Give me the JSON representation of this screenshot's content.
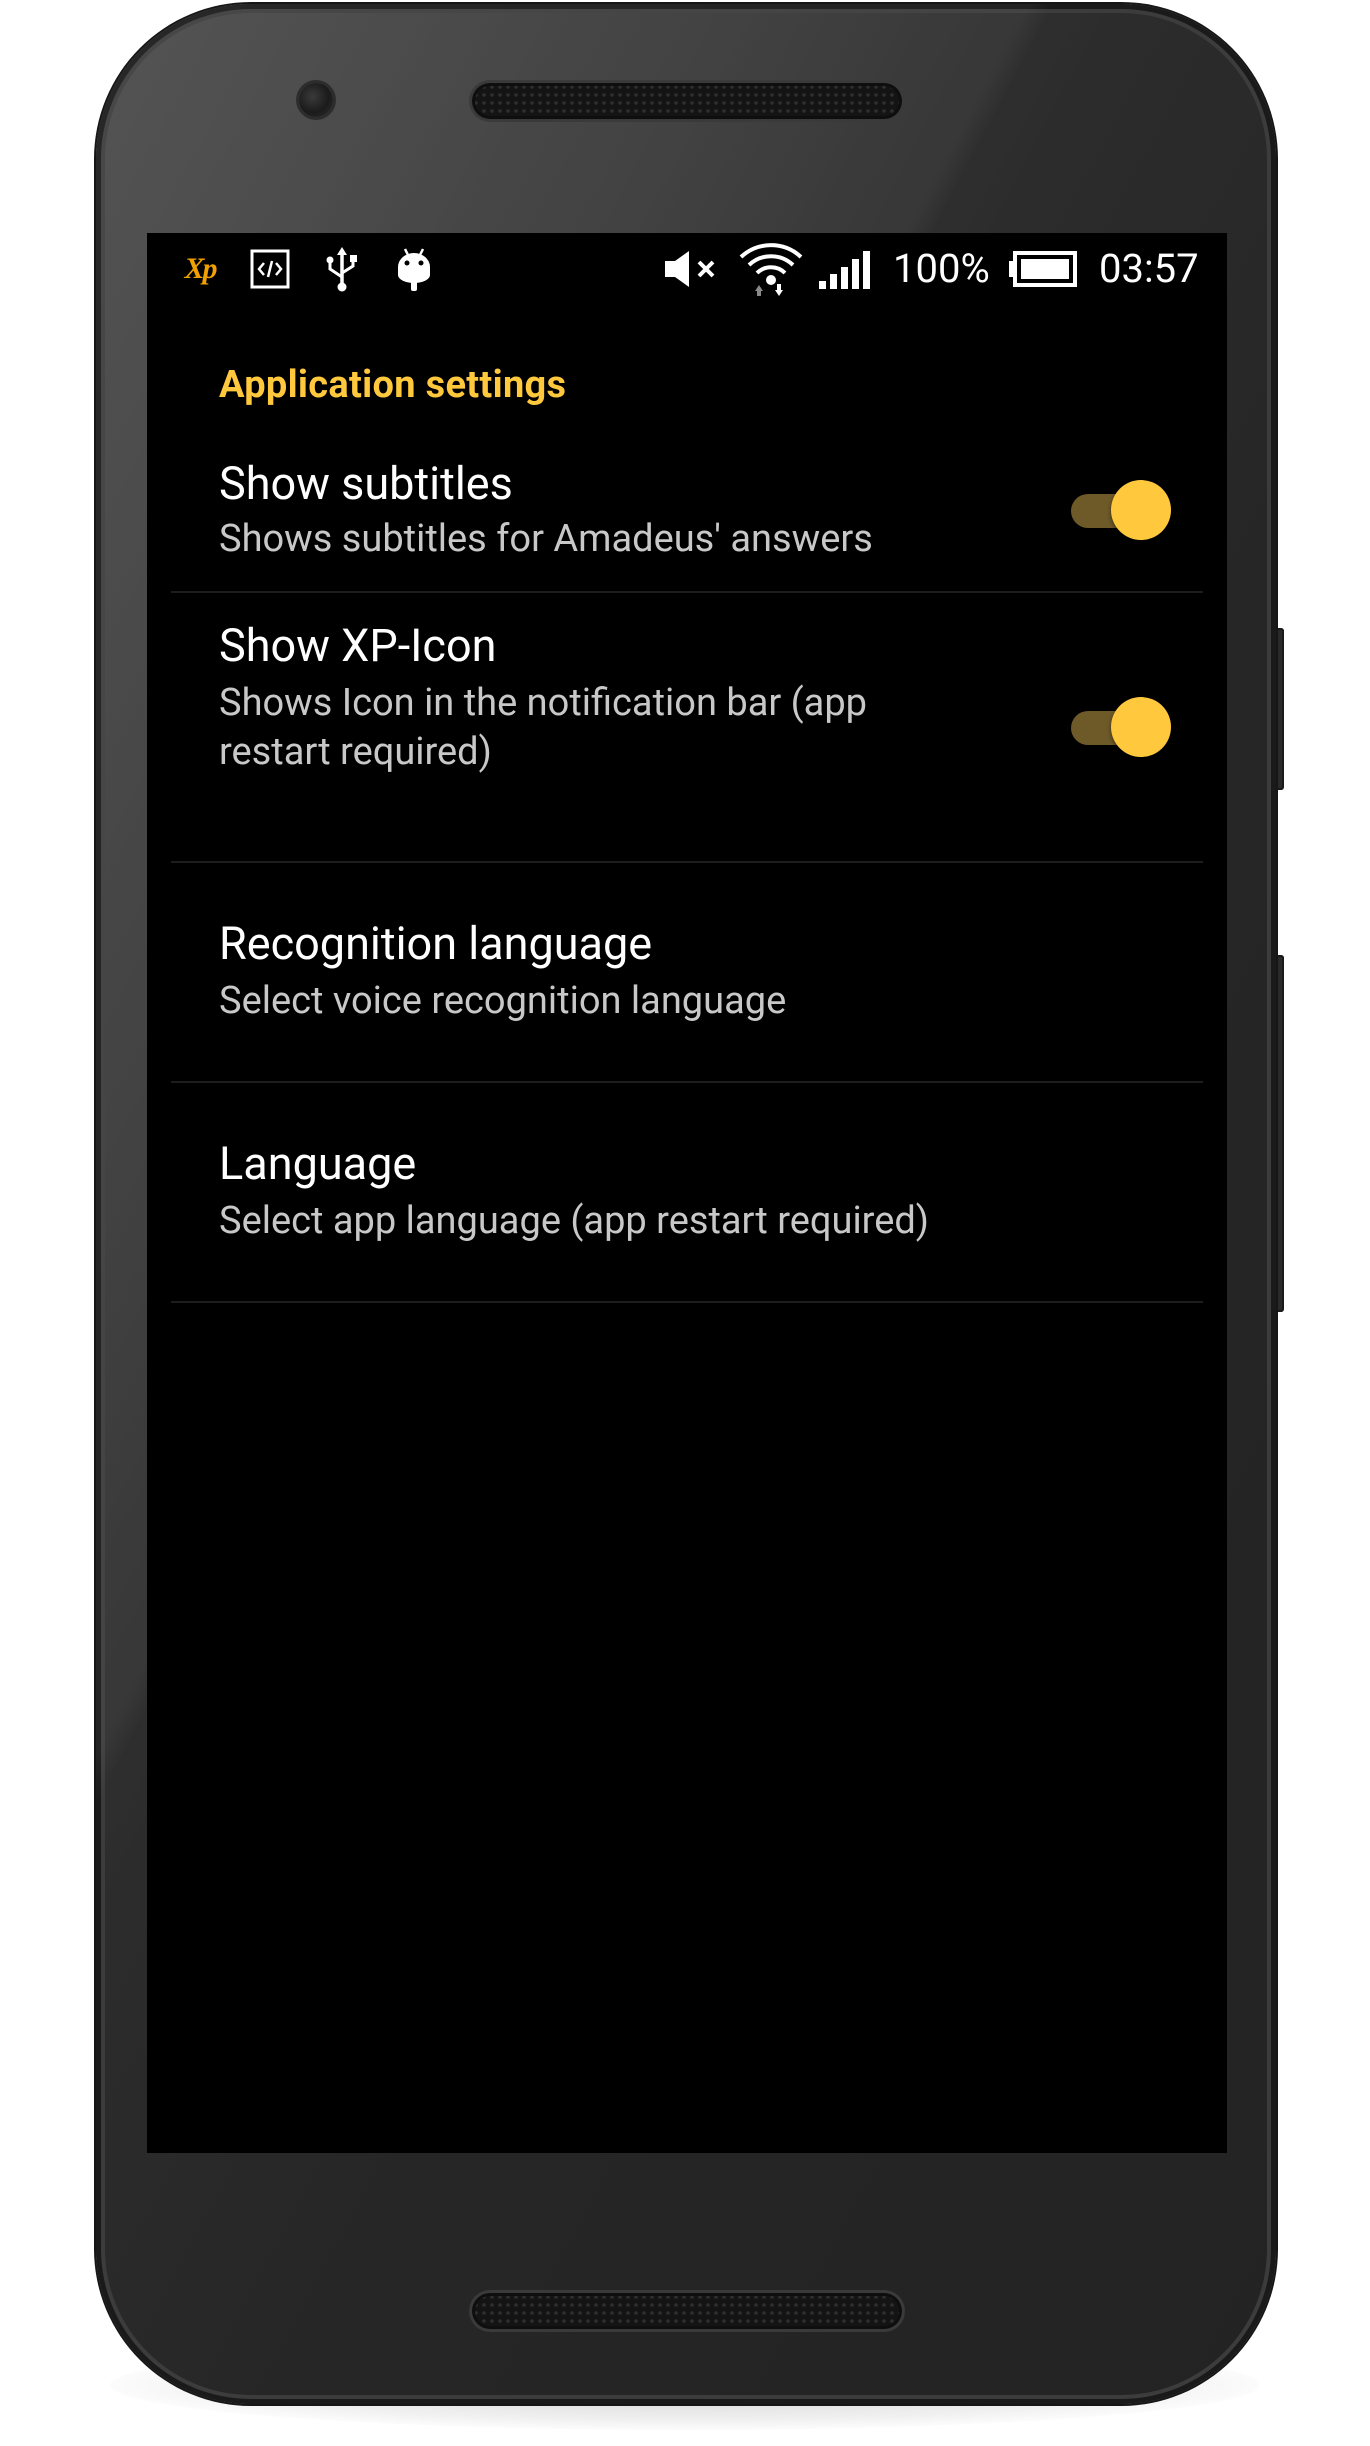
{
  "status_bar": {
    "icons": {
      "xp": "Xp",
      "developer": "code-icon",
      "usb": "usb-icon",
      "android": "android-icon",
      "mute": "volume-mute-icon",
      "wifi": "wifi-icon",
      "signal": "cell-signal-icon",
      "battery": "battery-full-icon"
    },
    "battery_percent": "100%",
    "time": "03:57"
  },
  "settings": {
    "category_title": "Application settings",
    "items": [
      {
        "title": "Show subtitles",
        "summary": "Shows subtitles for Amadeus' answers",
        "has_switch": true,
        "checked": true
      },
      {
        "title": "Show XP-Icon",
        "summary": "Shows Icon in the notification bar (app restart required)",
        "has_switch": true,
        "checked": true
      },
      {
        "title": "Recognition language",
        "summary": "Select voice recognition language",
        "has_switch": false
      },
      {
        "title": "Language",
        "summary": "Select app language (app restart required)",
        "has_switch": false
      }
    ]
  },
  "colors": {
    "accent": "#ffc83d",
    "switch_track": "#6e5a28",
    "screen_background": "#000000",
    "text_primary": "#ffffff",
    "text_secondary": "#c8c8c8",
    "xp_icon": "#f0a000"
  }
}
